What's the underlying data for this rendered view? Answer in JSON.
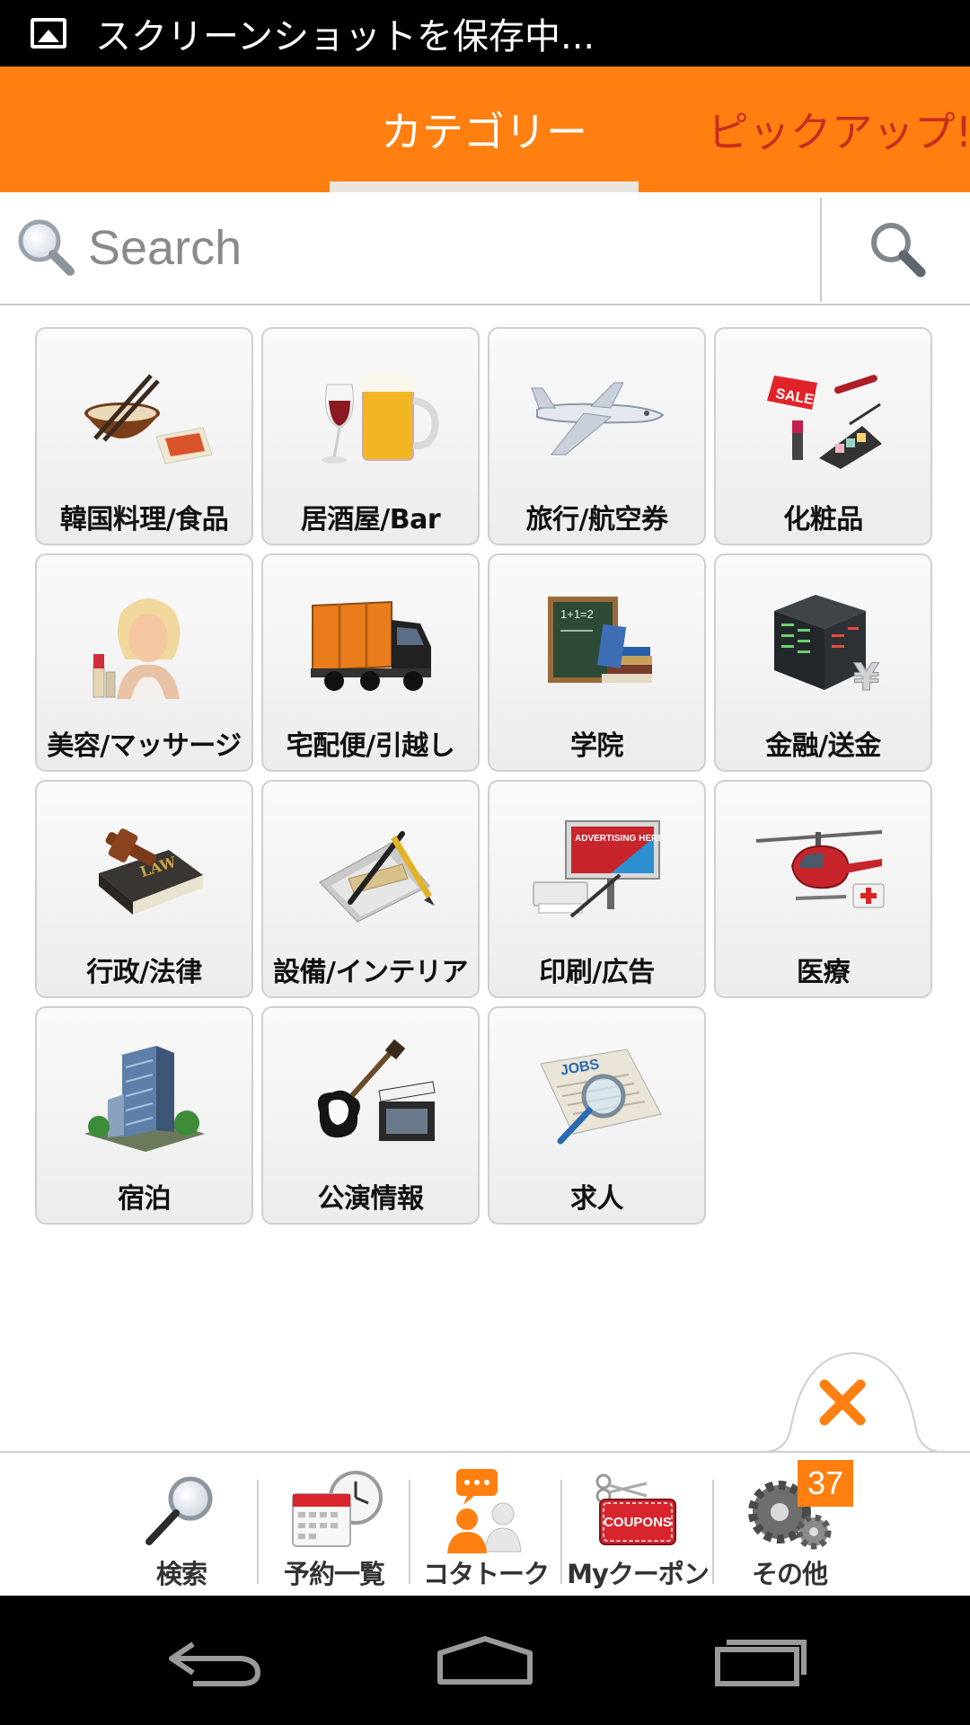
{
  "status_bar": {
    "text": "スクリーンショットを保存中..."
  },
  "tabs": [
    {
      "label": "カテゴリー",
      "selected": true
    },
    {
      "label": "ピックアップ!",
      "selected": false
    }
  ],
  "search": {
    "placeholder": "Search"
  },
  "categories": [
    {
      "label": "韓国料理/食品",
      "icon": "korean-food-icon"
    },
    {
      "label": "居酒屋/Bar",
      "icon": "beer-wine-icon"
    },
    {
      "label": "旅行/航空券",
      "icon": "airplane-icon"
    },
    {
      "label": "化粧品",
      "icon": "cosmetics-sale-icon"
    },
    {
      "label": "美容/マッサージ",
      "icon": "beauty-woman-icon"
    },
    {
      "label": "宅配便/引越し",
      "icon": "delivery-truck-icon"
    },
    {
      "label": "学院",
      "icon": "chalkboard-books-icon"
    },
    {
      "label": "金融/送金",
      "icon": "stock-board-yen-icon"
    },
    {
      "label": "行政/法律",
      "icon": "law-book-gavel-icon"
    },
    {
      "label": "設備/インテリア",
      "icon": "drafting-tools-icon"
    },
    {
      "label": "印刷/広告",
      "icon": "billboard-printer-icon"
    },
    {
      "label": "医療",
      "icon": "medical-helicopter-icon"
    },
    {
      "label": "宿泊",
      "icon": "hotel-building-icon"
    },
    {
      "label": "公演情報",
      "icon": "guitar-clapperboard-icon"
    },
    {
      "label": "求人",
      "icon": "jobs-newspaper-icon"
    }
  ],
  "bottom_nav": [
    {
      "label": "検索",
      "icon": "magnifier-icon"
    },
    {
      "label": "予約一覧",
      "icon": "calendar-clock-icon"
    },
    {
      "label": "コタトーク",
      "icon": "chat-people-icon"
    },
    {
      "label": "Myクーポン",
      "icon": "coupon-scissors-icon"
    },
    {
      "label": "その他",
      "icon": "gears-icon"
    }
  ],
  "badge": {
    "count": "37"
  },
  "coupon_text": "COUPONS",
  "colors": {
    "accent": "#ff7f10",
    "pickup_text": "#c62e1f",
    "nav_bg": "#000000"
  }
}
